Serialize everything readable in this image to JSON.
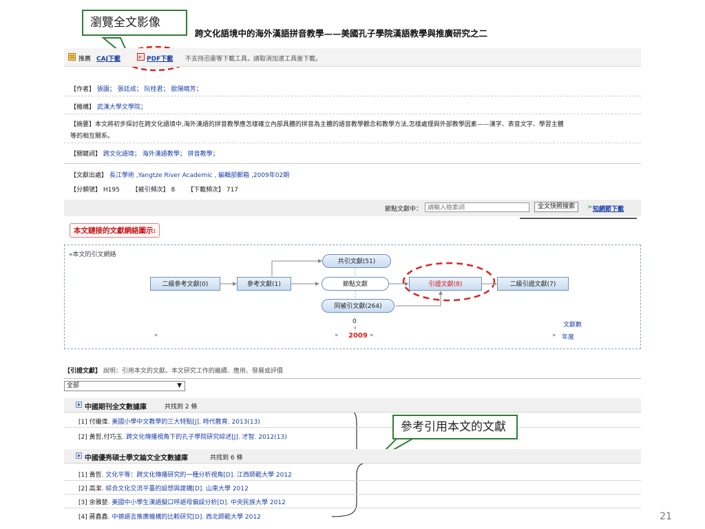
{
  "callouts": {
    "browse": "瀏覽全文影像",
    "cite": "參考引用本文的文獻"
  },
  "article": {
    "title": "跨文化語境中的海外漢語拼音教學——美國孔子學院漢語教學與推廣研究之二"
  },
  "toolbar": {
    "recommend_label": "推薦",
    "caj": "CAJ下載",
    "pdf": "PDF下載",
    "notice": "不支持迅雷等下載工具，請取消加速工具後下載。"
  },
  "meta": {
    "author_label": "【作者】",
    "authors": [
      "張園；",
      "張廷成；",
      "阮桂君；",
      "歐陽曉芳；"
    ],
    "org_label": "【機構】",
    "org": "武漢大學文學院；",
    "abstract_label": "【摘要】",
    "abstract_line1": "本文將初步探討在跨文化語境中,海外漢語的拼音教學應怎樣確立內部具體的拼音為主體的語音教學觀念和教學方法,怎樣處理與外部教學因素——漢字、表音文字、學習主體",
    "abstract_line2": "等的相互關系。",
    "keywords_label": "【關鍵詞】",
    "keywords": [
      "跨文化語境；",
      "海外漢語教學；",
      "拼音教學；"
    ],
    "source_label": "【文獻出處】",
    "source": "長江學術 ,Yangtze River Academic , 編輯部郵箱 ,2009年02期",
    "class_label": "【分類號】",
    "class_value": "H195",
    "cited_label": "【被引頻次】",
    "cited_value": "8",
    "download_label": "【下載頻次】",
    "download_value": "717"
  },
  "search": {
    "label": "節點文獻中：",
    "placeholder": "請輸入檢索詞",
    "button": "全文快照搜索",
    "link": "知網節下載"
  },
  "network": {
    "section_title": "本文鏈接的文獻網絡圖示:",
    "subtitle": "»本文的引文網絡",
    "nodes": {
      "secondary_refs": "二級參考文獻(0)",
      "refs": "參考文獻(1)",
      "node_doc": "節點文獻",
      "citing": "引證文獻(8)",
      "secondary_citing": "二級引證文獻(7)",
      "co_cited": "共引文獻(51)",
      "co_citing": "同被引文獻(264)"
    },
    "count_value": "0",
    "year_value": "2009",
    "legend_count": "文獻數",
    "legend_year": "年度",
    "nav_left": "«",
    "nav_prev": "»",
    "nav_next": "«",
    "nav_right": "»"
  },
  "citing": {
    "header_label": "【引證文獻】",
    "header_desc": "說明：引用本文的文獻。本文研究工作的繼續、應用、發展或評價",
    "select_value": "全部",
    "db1_title": "中國期刊全文數據庫",
    "db1_count": "共找到 2 條",
    "db1_items": [
      {
        "num": "[1] 付繼偉.",
        "title": "美國小學中文教學的三大特點",
        "src": "[J]. 時代教育. 2013(13)"
      },
      {
        "num": "[2] 黃哲,付巧玉.",
        "title": "跨文化傳播視角下的孔子學院研究綜述",
        "src": "[J]. 才智. 2012(13)"
      }
    ],
    "db2_title": "中國優秀碩士學文論文全文數據庫",
    "db2_count": "共找到 6 條",
    "db2_items": [
      {
        "num": "[1] 黃哲.",
        "title": "文化平等：跨文化傳播研究的一種分析視角",
        "src": "[D]. 江西師範大學 2012"
      },
      {
        "num": "[2] 高潔.",
        "title": "綜合文化交流平臺的設想與建構",
        "src": "[D]. 山東大學 2012"
      },
      {
        "num": "[3] 余雅婪.",
        "title": "美國中小學生漢語擬口呼語母偏誤分析",
        "src": "[D]. 中央民族大學 2012"
      },
      {
        "num": "[4] 蔣鑫鑫.",
        "title": "中德語言推廣機構的比較研究",
        "src": "[D]. 西北師範大學 2012"
      }
    ]
  },
  "slide": {
    "page_number": "21"
  }
}
